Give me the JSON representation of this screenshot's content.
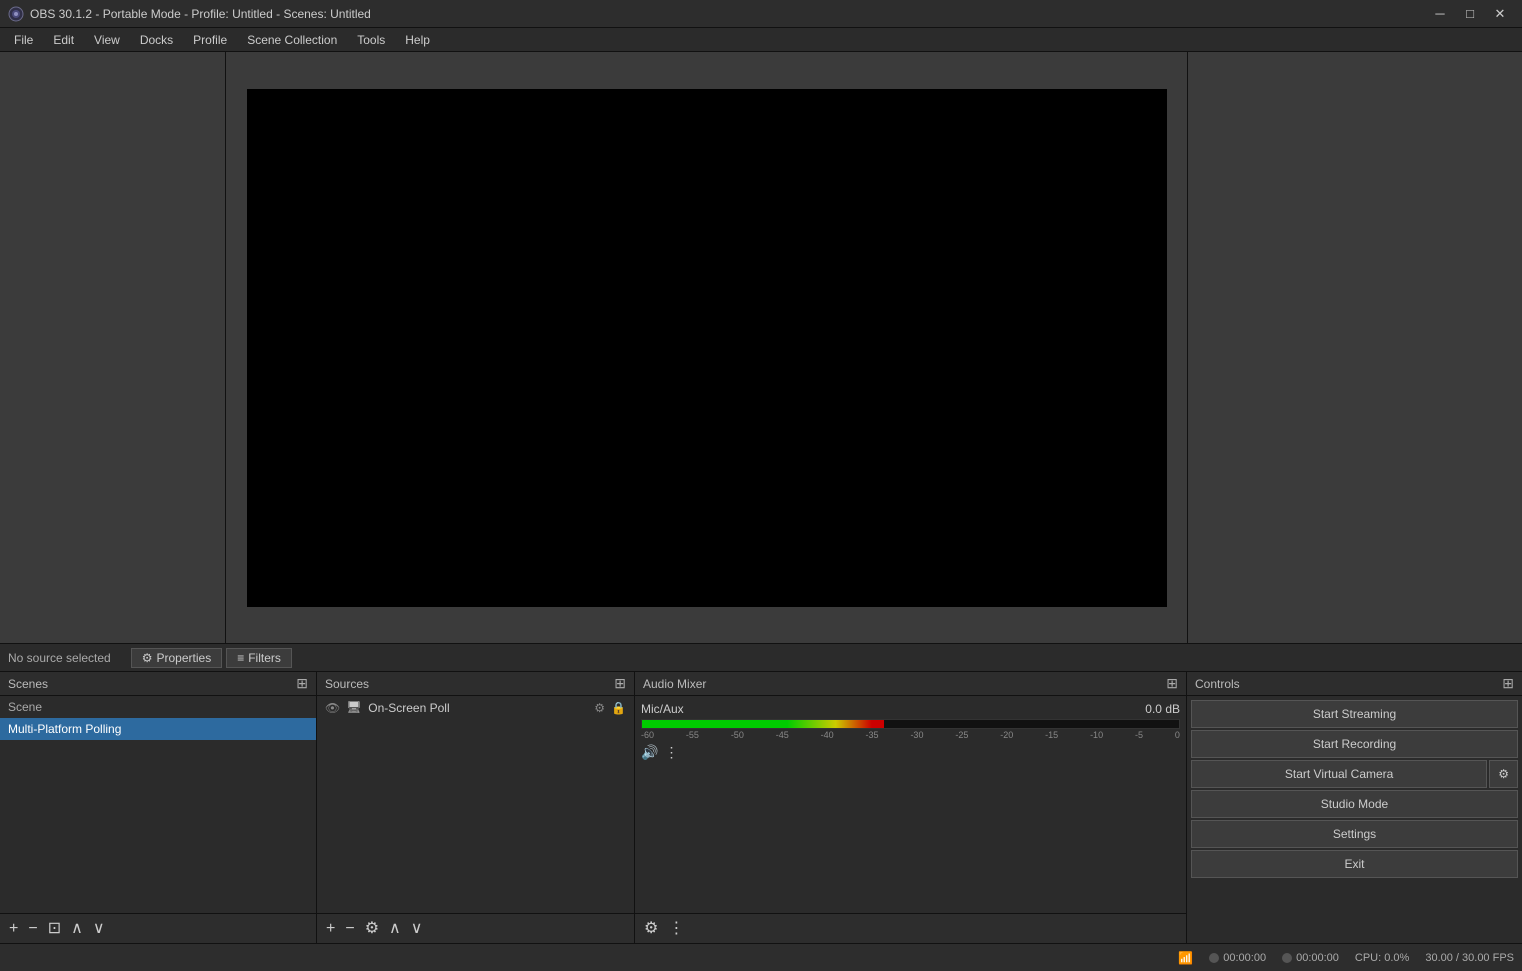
{
  "titlebar": {
    "title": "OBS 30.1.2 - Portable Mode - Profile: Untitled - Scenes: Untitled",
    "logo": "OBS",
    "minimize_label": "─",
    "maximize_label": "□",
    "close_label": "✕"
  },
  "menubar": {
    "items": [
      {
        "label": "File"
      },
      {
        "label": "Edit"
      },
      {
        "label": "View"
      },
      {
        "label": "Docks"
      },
      {
        "label": "Profile"
      },
      {
        "label": "Scene Collection"
      },
      {
        "label": "Tools"
      },
      {
        "label": "Help"
      }
    ]
  },
  "props_bar": {
    "no_source_label": "No source selected",
    "properties_label": "Properties",
    "filters_label": "Filters",
    "properties_icon": "⚙",
    "filters_icon": "≡"
  },
  "scenes_panel": {
    "header": "Scenes",
    "header_icon": "⊞",
    "items": [
      {
        "label": "Scene",
        "selected": false,
        "is_header": true
      },
      {
        "label": "Multi-Platform Polling",
        "selected": true,
        "is_header": false
      }
    ],
    "footer_buttons": [
      {
        "label": "+",
        "name": "add-scene"
      },
      {
        "label": "−",
        "name": "remove-scene"
      },
      {
        "label": "⊡",
        "name": "scene-filter"
      },
      {
        "label": "∧",
        "name": "move-scene-up"
      },
      {
        "label": "∨",
        "name": "move-scene-down"
      }
    ]
  },
  "sources_panel": {
    "header": "Sources",
    "header_icon": "⊞",
    "items": [
      {
        "name": "On-Screen Poll",
        "icon": "●",
        "eye": true,
        "lock": true
      }
    ],
    "footer_buttons": [
      {
        "label": "+",
        "name": "add-source"
      },
      {
        "label": "−",
        "name": "remove-source"
      },
      {
        "label": "⚙",
        "name": "source-settings"
      },
      {
        "label": "∧",
        "name": "move-source-up"
      },
      {
        "label": "∨",
        "name": "move-source-down"
      }
    ]
  },
  "audio_panel": {
    "header": "Audio Mixer",
    "header_icon": "⊞",
    "channels": [
      {
        "name": "Mic/Aux",
        "db": "0.0 dB",
        "meter_pct": 45,
        "scale": [
          "-60",
          "-55",
          "-50",
          "-45",
          "-40",
          "-35",
          "-30",
          "-25",
          "-20",
          "-15",
          "-10",
          "-5",
          "0"
        ]
      }
    ],
    "footer_buttons": [
      {
        "label": "⚙",
        "name": "audio-settings"
      },
      {
        "label": "⋮",
        "name": "audio-more"
      }
    ]
  },
  "controls_panel": {
    "header": "Controls",
    "header_icon": "⊞",
    "buttons": [
      {
        "label": "Start Streaming",
        "name": "start-streaming"
      },
      {
        "label": "Start Recording",
        "name": "start-recording"
      },
      {
        "label": "Start Virtual Camera",
        "name": "start-virtual-camera"
      },
      {
        "label": "Studio Mode",
        "name": "studio-mode"
      },
      {
        "label": "Settings",
        "name": "settings"
      },
      {
        "label": "Exit",
        "name": "exit"
      }
    ],
    "virtual_camera_settings_icon": "⚙"
  },
  "statusbar": {
    "network_icon": "📶",
    "stream_time": "00:00:00",
    "record_time": "00:00:00",
    "cpu_label": "CPU: 0.0%",
    "fps_label": "30.00 / 30.00 FPS"
  }
}
